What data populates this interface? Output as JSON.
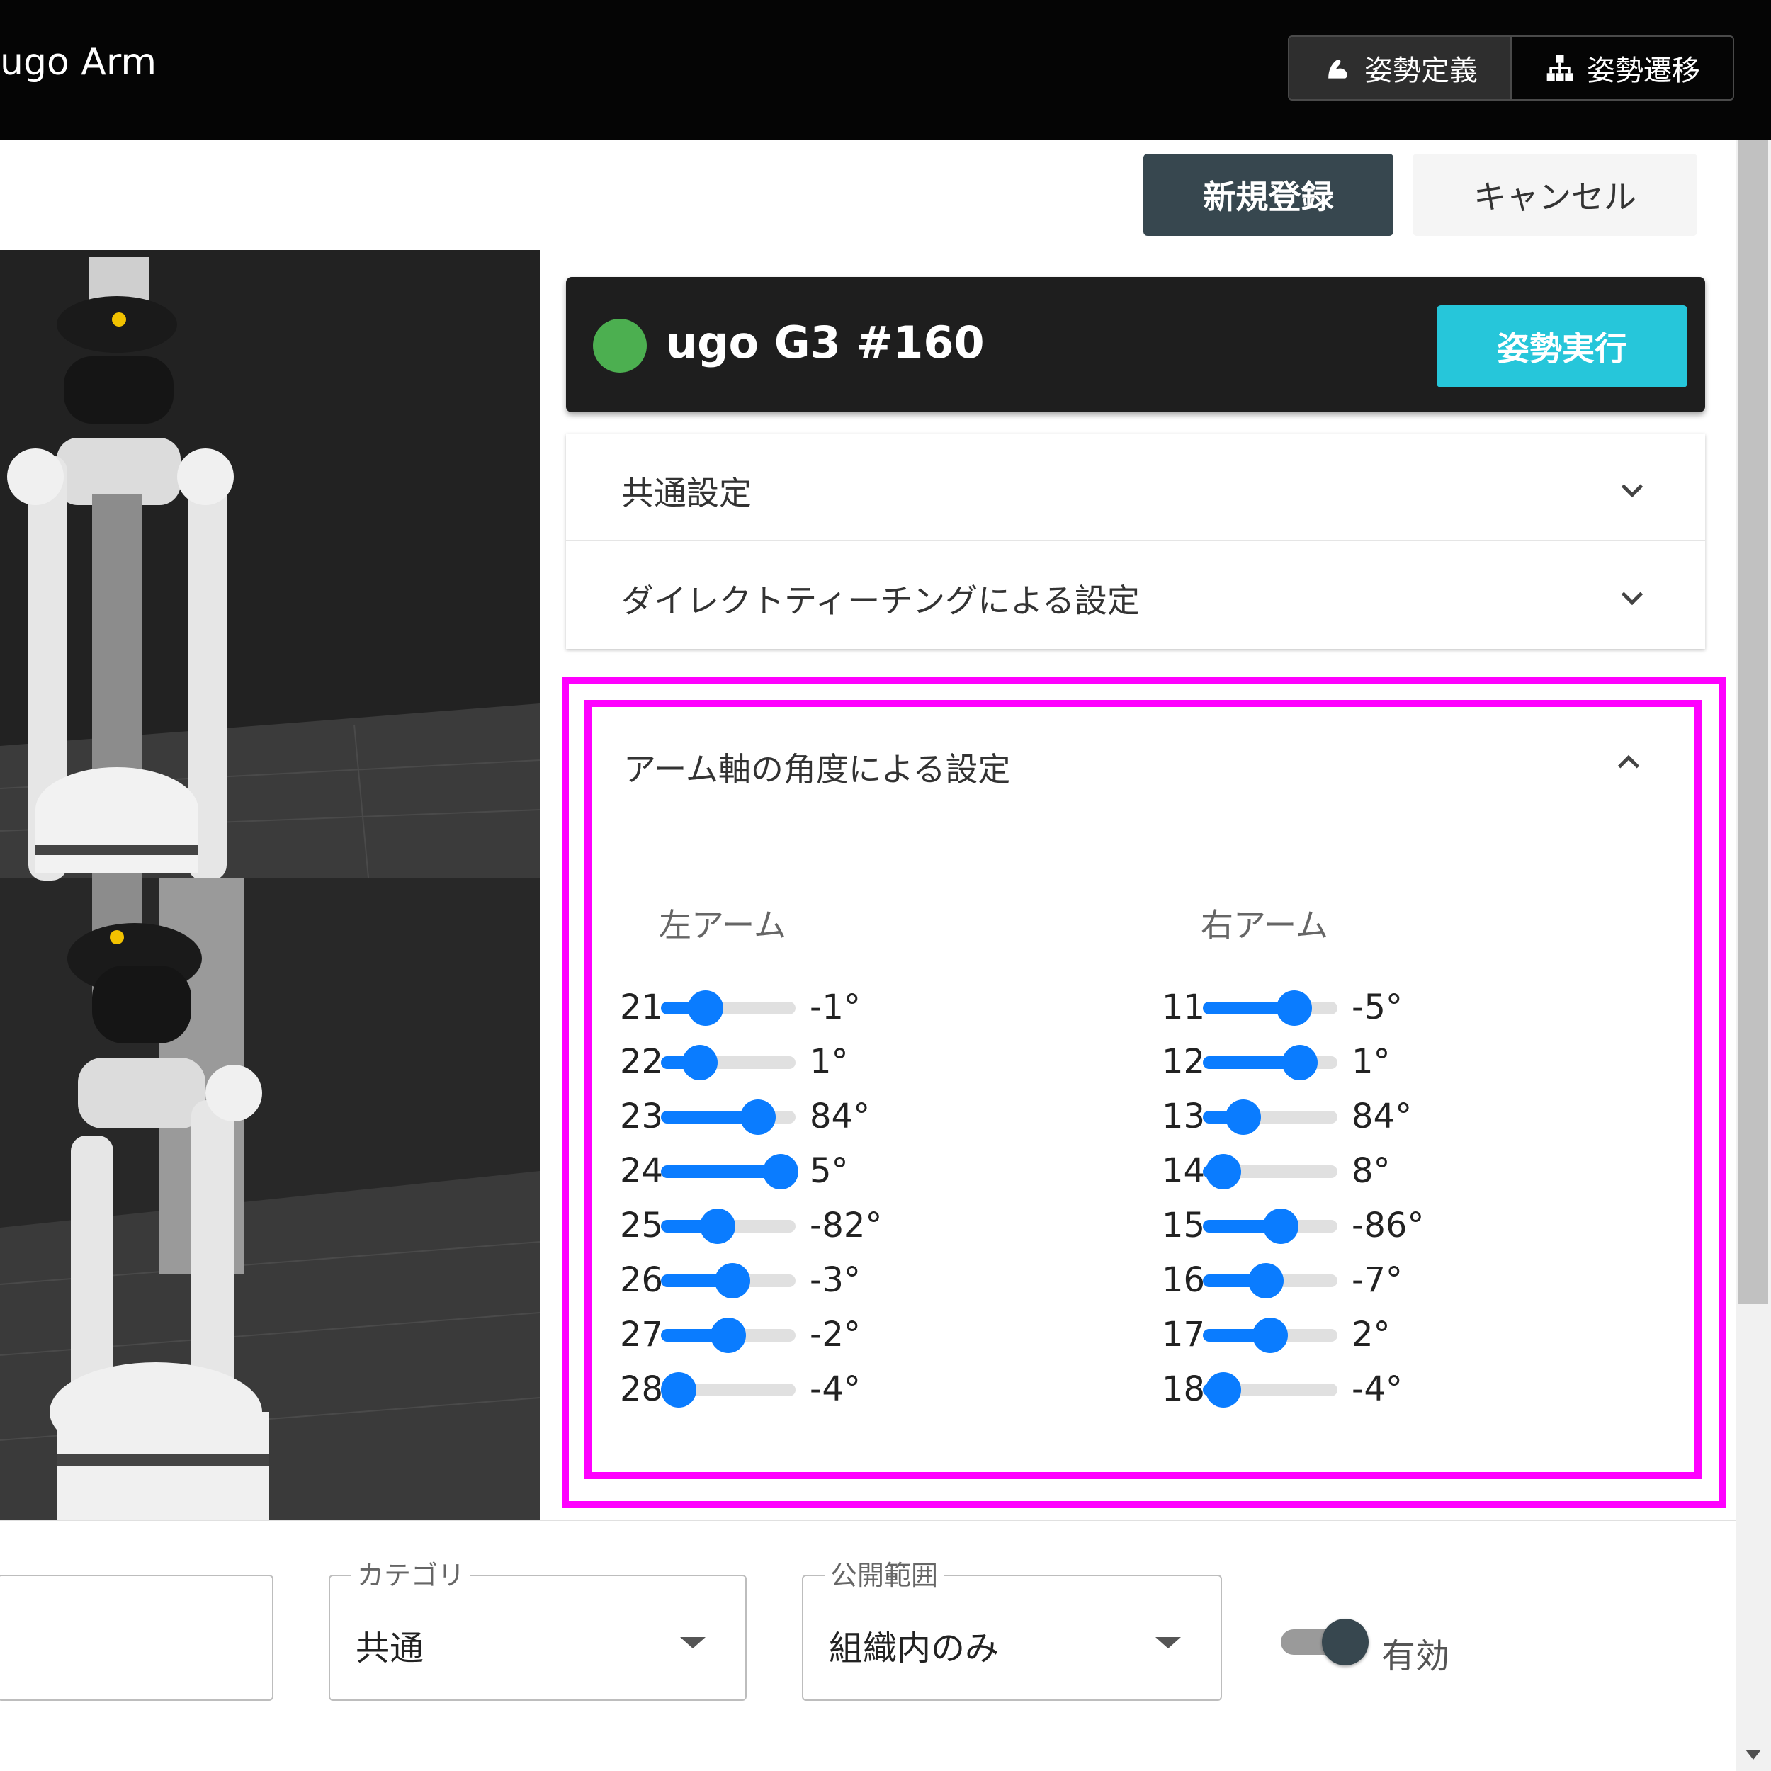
{
  "app": {
    "title": "ugo Arm"
  },
  "nav": {
    "tabs": [
      {
        "label": "姿勢定義",
        "icon": "arm-icon"
      },
      {
        "label": "姿勢遷移",
        "icon": "sitemap-icon"
      }
    ]
  },
  "actions": {
    "register": "新規登録",
    "cancel": "キャンセル"
  },
  "robot": {
    "name": "ugo G3 #160",
    "status_color": "#4caf50",
    "execute": "姿勢実行",
    "execute_color": "#26c6da"
  },
  "accordions": [
    {
      "label": "共通設定"
    },
    {
      "label": "ダイレクトティーチングによる設定"
    }
  ],
  "arm_panel": {
    "title": "アーム軸の角度による設定",
    "left": {
      "title": "左アーム",
      "joints": [
        {
          "id": "21",
          "label": "-1°",
          "fraction": 0.33
        },
        {
          "id": "22",
          "label": "1°",
          "fraction": 0.29
        },
        {
          "id": "23",
          "label": "84°",
          "fraction": 0.72
        },
        {
          "id": "24",
          "label": "5°",
          "fraction": 0.89
        },
        {
          "id": "25",
          "label": "-82°",
          "fraction": 0.42
        },
        {
          "id": "26",
          "label": "-3°",
          "fraction": 0.53
        },
        {
          "id": "27",
          "label": "-2°",
          "fraction": 0.5
        },
        {
          "id": "28",
          "label": "-4°",
          "fraction": 0.13
        }
      ]
    },
    "right": {
      "title": "右アーム",
      "joints": [
        {
          "id": "11",
          "label": "-5°",
          "fraction": 0.68
        },
        {
          "id": "12",
          "label": "1°",
          "fraction": 0.72
        },
        {
          "id": "13",
          "label": "84°",
          "fraction": 0.3
        },
        {
          "id": "14",
          "label": "8°",
          "fraction": 0.15
        },
        {
          "id": "15",
          "label": "-86°",
          "fraction": 0.58
        },
        {
          "id": "16",
          "label": "-7°",
          "fraction": 0.47
        },
        {
          "id": "17",
          "label": "2°",
          "fraction": 0.5
        },
        {
          "id": "18",
          "label": "-4°",
          "fraction": 0.15
        }
      ]
    }
  },
  "form": {
    "category": {
      "legend": "カテゴリ",
      "value": "共通"
    },
    "visibility": {
      "legend": "公開範囲",
      "value": "組織内のみ"
    },
    "enabled": {
      "label": "有効",
      "on": true
    }
  },
  "colors": {
    "slider": "#0a7cff",
    "highlight": "#ff00ff"
  }
}
